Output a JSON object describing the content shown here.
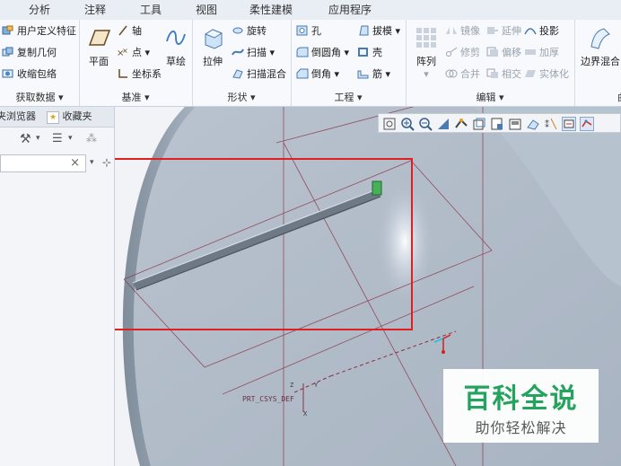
{
  "tabs": [
    "分析",
    "注释",
    "工具",
    "视图",
    "柔性建模",
    "应用程序"
  ],
  "groups": {
    "get_data": {
      "title": "获取数据",
      "items": [
        "用户定义特征",
        "复制几何",
        "收缩包络"
      ]
    },
    "datum": {
      "title": "基准",
      "plane": "平面",
      "axis": "轴",
      "point": "点",
      "csys": "坐标系",
      "sketch": "草绘"
    },
    "shapes": {
      "title": "形状",
      "extrude": "拉伸",
      "revolve": "旋转",
      "sweep": "扫描",
      "swept_blend": "扫描混合"
    },
    "engineering": {
      "title": "工程",
      "hole": "孔",
      "round": "倒圆角",
      "chamfer": "倒角",
      "draft": "拔模",
      "shell": "壳",
      "rib": "筋"
    },
    "editing": {
      "title": "编辑",
      "pattern": "阵列",
      "mirror": "镜像",
      "extend": "延伸",
      "project": "投影",
      "trim": "修剪",
      "offset": "偏移",
      "thicken": "加厚",
      "merge": "合并",
      "intersect": "相交",
      "solidify": "实体化"
    },
    "surfaces": {
      "title": "曲",
      "boundary_blend": "边界混合"
    }
  },
  "left_panel": {
    "tab_browser": "夹浏览器",
    "tab_favorites": "收藏夹",
    "search_clear": "×"
  },
  "viewport": {
    "csys_label": "PRT_CSYS_DEF",
    "axis_x": "X",
    "axis_y": "Y",
    "axis_z": "Z"
  },
  "watermark": {
    "line1": "百科全说",
    "line2": "助你轻松解决"
  },
  "colors": {
    "ribbon_bg": "#f7f9fc",
    "model_surface": "#aab6c6",
    "highlight_box": "#e02020",
    "datum_lines": "#8a3040",
    "watermark_green": "#1fa35a"
  }
}
